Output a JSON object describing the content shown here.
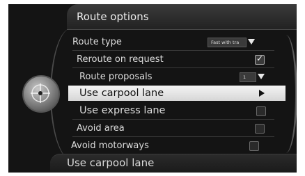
{
  "header": {
    "title": "Route options"
  },
  "footer": {
    "text": "Use carpool lane"
  },
  "menu": {
    "route_type": {
      "label": "Route type",
      "value": "Fast with tra"
    },
    "reroute": {
      "label": "Reroute on request",
      "checked": true
    },
    "proposals": {
      "label": "Route proposals",
      "value": "1"
    },
    "carpool": {
      "label": "Use carpool lane"
    },
    "express": {
      "label": "Use express lane",
      "checked": false
    },
    "avoid_area": {
      "label": "Avoid area",
      "checked": false
    },
    "motorways": {
      "label": "Avoid motorways",
      "checked": false
    }
  },
  "knob": {
    "icon": "crosshair-knob-icon"
  }
}
